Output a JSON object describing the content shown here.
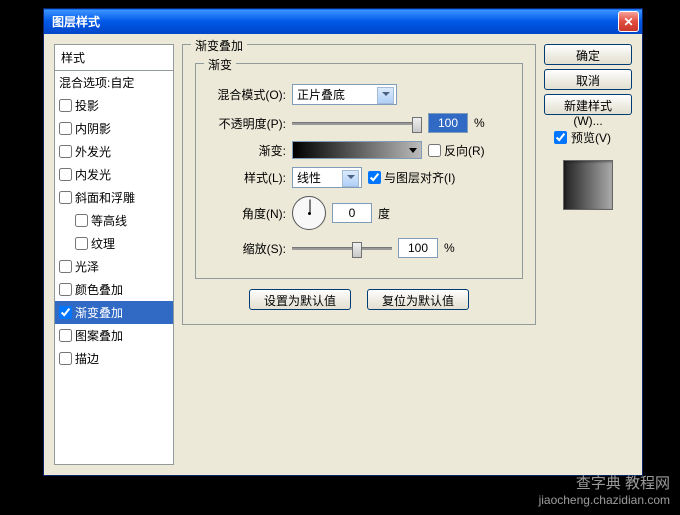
{
  "title": "图层样式",
  "close": "X",
  "styles_header": "样式",
  "styles": {
    "blend_options": "混合选项:自定",
    "drop_shadow": "投影",
    "inner_shadow": "内阴影",
    "outer_glow": "外发光",
    "inner_glow": "内发光",
    "bevel": "斜面和浮雕",
    "contour": "等高线",
    "texture": "纹理",
    "satin": "光泽",
    "color_overlay": "颜色叠加",
    "gradient_overlay": "渐变叠加",
    "pattern_overlay": "图案叠加",
    "stroke": "描边"
  },
  "panel": {
    "section_title": "渐变叠加",
    "gradient_group": "渐变",
    "blend_mode_label": "混合模式(O):",
    "blend_mode_value": "正片叠底",
    "opacity_label": "不透明度(P):",
    "opacity_value": "100",
    "percent": "%",
    "gradient_label": "渐变:",
    "reverse_label": "反向(R)",
    "style_label": "样式(L):",
    "style_value": "线性",
    "align_label": "与图层对齐(I)",
    "angle_label": "角度(N):",
    "angle_value": "0",
    "degree": "度",
    "scale_label": "缩放(S):",
    "scale_value": "100",
    "make_default": "设置为默认值",
    "reset_default": "复位为默认值"
  },
  "buttons": {
    "ok": "确定",
    "cancel": "取消",
    "new_style": "新建样式(W)...",
    "preview": "预览(V)"
  },
  "watermark": {
    "line1": "查字典 教程网",
    "line2": "jiaocheng.chazidian.com"
  }
}
